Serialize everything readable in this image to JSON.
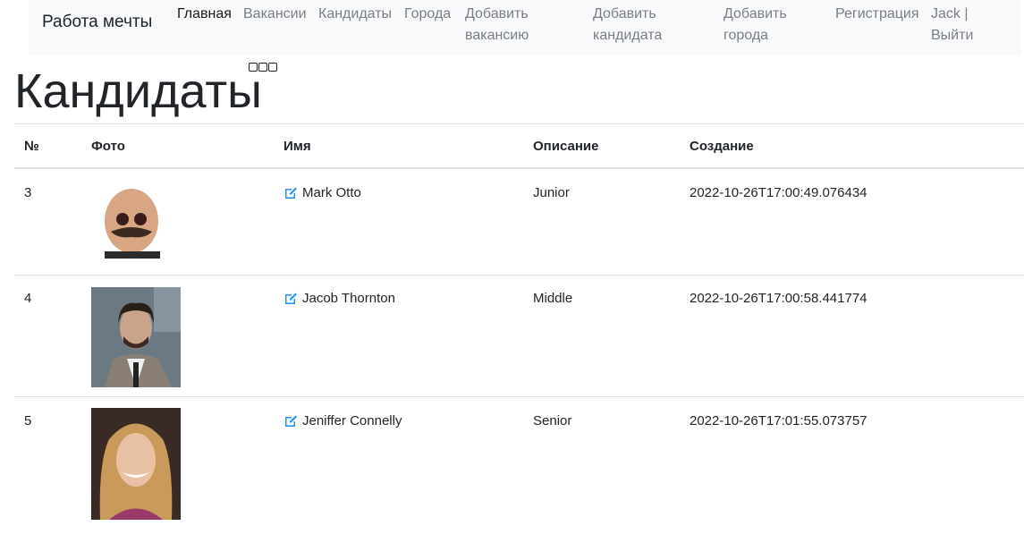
{
  "nav": {
    "brand": "Работа мечты",
    "items": [
      {
        "label": "Главная"
      },
      {
        "label": "Вакансии"
      },
      {
        "label": "Кандидаты"
      },
      {
        "label": "Города"
      },
      {
        "label": "Добавить\nвакансию"
      },
      {
        "label": "Добавить\nкандидата"
      },
      {
        "label": "Добавить\nгорода"
      },
      {
        "label": "Регистрация"
      },
      {
        "label": "Jack |\nВыйти"
      }
    ]
  },
  "page": {
    "title": "Кандидаты"
  },
  "table": {
    "headers": [
      "№",
      "Фото",
      "Имя",
      "Описание",
      "Создание"
    ],
    "rows": [
      {
        "id": "3",
        "name": "Mark Otto",
        "description": "Junior",
        "created": "2022-10-26T17:00:49.076434"
      },
      {
        "id": "4",
        "name": "Jacob Thornton",
        "description": "Middle",
        "created": "2022-10-26T17:00:58.441774"
      },
      {
        "id": "5",
        "name": "Jeniffer Connelly",
        "description": "Senior",
        "created": "2022-10-26T17:01:55.073757"
      }
    ]
  },
  "colors": {
    "navbar_bg": "#f8f9fa",
    "link_icon": "#1e90ff",
    "border": "#dee2e6"
  }
}
